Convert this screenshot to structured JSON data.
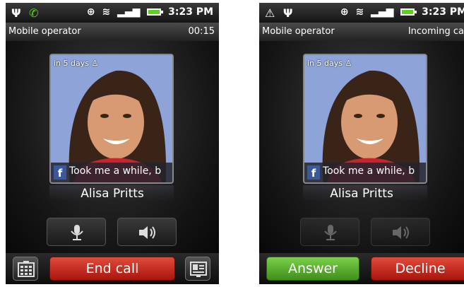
{
  "left_screen": {
    "status_bar": {
      "time": "3:23 PM",
      "icons": [
        "usb-icon",
        "phone-call-icon",
        "gps-icon",
        "wifi-icon",
        "signal-icon",
        "battery-icon"
      ]
    },
    "operator": "Mobile operator",
    "call_timer": "00:15",
    "contact": {
      "days_label": "in 5 days",
      "status_update": "Took me a while, b",
      "status_source_icon": "facebook-icon",
      "name": "Alisa Pritts"
    },
    "controls": {
      "mute_icon": "microphone-icon",
      "speaker_icon": "speaker-icon",
      "mute_enabled": true,
      "speaker_enabled": true
    },
    "bottom": {
      "end_call_label": "End call",
      "dialpad_icon": "dialpad-icon",
      "contact_icon": "contact-card-icon"
    }
  },
  "right_screen": {
    "status_bar": {
      "time": "3:23 PM",
      "icons": [
        "warning-icon",
        "usb-icon",
        "gps-icon",
        "wifi-icon",
        "signal-icon",
        "battery-icon"
      ]
    },
    "operator": "Mobile operator",
    "call_status": "Incoming ca",
    "contact": {
      "days_label": "in 5 days",
      "status_update": "Took me a while, b",
      "status_source_icon": "facebook-icon",
      "name": "Alisa Pritts"
    },
    "controls": {
      "mute_icon": "microphone-icon",
      "speaker_icon": "speaker-icon",
      "mute_enabled": false,
      "speaker_enabled": false
    },
    "bottom": {
      "answer_label": "Answer",
      "decline_label": "Decline"
    }
  },
  "colors": {
    "end_call": "#c52a1e",
    "answer": "#5aae2c",
    "decline": "#c52a1e",
    "status_green": "#5fd21e",
    "facebook": "#3b5998"
  }
}
